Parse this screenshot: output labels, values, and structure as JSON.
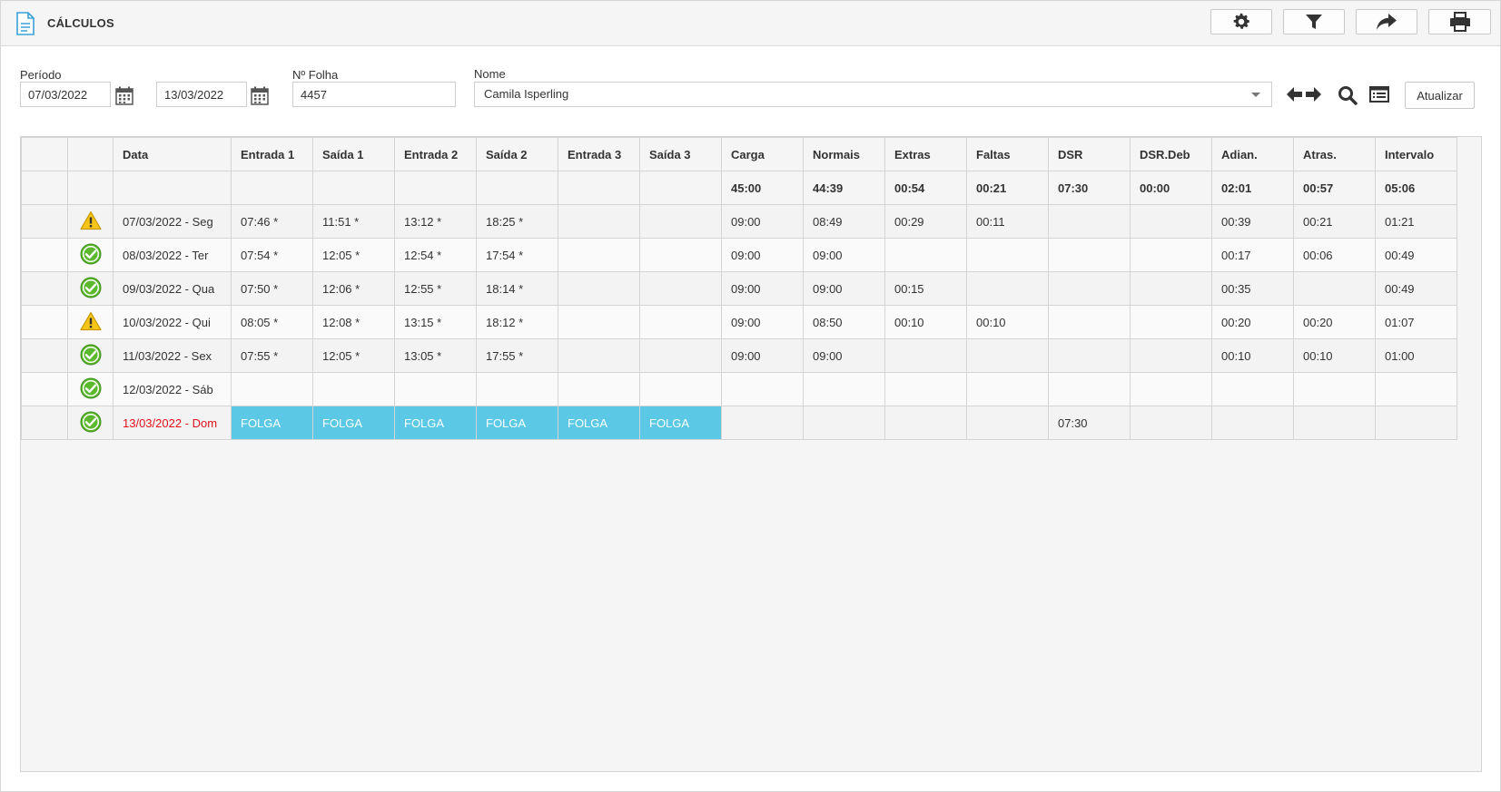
{
  "app": {
    "title": "CÁLCULOS"
  },
  "toolbar": {
    "icons": [
      "gear-icon",
      "filter-icon",
      "share-icon",
      "print-icon"
    ]
  },
  "filters": {
    "period_label": "Período",
    "date_start": "07/03/2022",
    "date_end": "13/03/2022",
    "sheet_label": "Nº Folha",
    "sheet_value": "4457",
    "name_label": "Nome",
    "name_value": "Camila Isperling",
    "update_label": "Atualizar"
  },
  "colors": {
    "accent": "#3aa0d8",
    "folga": "#5bc8e6",
    "sunday": "#e0111b",
    "ok": "#5cb82e",
    "warning": "#f0b400"
  },
  "grid": {
    "headers": [
      "",
      "",
      "Data",
      "Entrada 1",
      "Saída 1",
      "Entrada 2",
      "Saída 2",
      "Entrada 3",
      "Saída 3",
      "Carga",
      "Normais",
      "Extras",
      "Faltas",
      "DSR",
      "DSR.Deb",
      "Adian.",
      "Atras.",
      "Intervalo"
    ],
    "totals": [
      "",
      "",
      "",
      "",
      "",
      "",
      "",
      "",
      "",
      "45:00",
      "44:39",
      "00:54",
      "00:21",
      "07:30",
      "00:00",
      "02:01",
      "00:57",
      "05:06"
    ],
    "rows": [
      {
        "status": "warning",
        "cells": [
          "07/03/2022 - Seg",
          "07:46 *",
          "11:51 *",
          "13:12 *",
          "18:25 *",
          "",
          "",
          "09:00",
          "08:49",
          "00:29",
          "00:11",
          "",
          "",
          "00:39",
          "00:21",
          "01:21"
        ]
      },
      {
        "status": "ok",
        "cells": [
          "08/03/2022 - Ter",
          "07:54 *",
          "12:05 *",
          "12:54 *",
          "17:54 *",
          "",
          "",
          "09:00",
          "09:00",
          "",
          "",
          "",
          "",
          "00:17",
          "00:06",
          "00:49"
        ]
      },
      {
        "status": "ok",
        "cells": [
          "09/03/2022 - Qua",
          "07:50 *",
          "12:06 *",
          "12:55 *",
          "18:14 *",
          "",
          "",
          "09:00",
          "09:00",
          "00:15",
          "",
          "",
          "",
          "00:35",
          "",
          "00:49"
        ]
      },
      {
        "status": "warning",
        "cells": [
          "10/03/2022 - Qui",
          "08:05 *",
          "12:08 *",
          "13:15 *",
          "18:12 *",
          "",
          "",
          "09:00",
          "08:50",
          "00:10",
          "00:10",
          "",
          "",
          "00:20",
          "00:20",
          "01:07"
        ]
      },
      {
        "status": "ok",
        "cells": [
          "11/03/2022 - Sex",
          "07:55 *",
          "12:05 *",
          "13:05 *",
          "17:55 *",
          "",
          "",
          "09:00",
          "09:00",
          "",
          "",
          "",
          "",
          "00:10",
          "00:10",
          "01:00"
        ]
      },
      {
        "status": "ok",
        "cells": [
          "12/03/2022 - Sáb",
          "",
          "",
          "",
          "",
          "",
          "",
          "",
          "",
          "",
          "",
          "",
          "",
          "",
          "",
          ""
        ]
      },
      {
        "status": "ok",
        "sunday": true,
        "folga_cols": [
          1,
          2,
          3,
          4,
          5,
          6
        ],
        "cells": [
          "13/03/2022 - Dom",
          "FOLGA",
          "FOLGA",
          "FOLGA",
          "FOLGA",
          "FOLGA",
          "FOLGA",
          "",
          "",
          "",
          "",
          "07:30",
          "",
          "",
          "",
          ""
        ]
      }
    ]
  }
}
